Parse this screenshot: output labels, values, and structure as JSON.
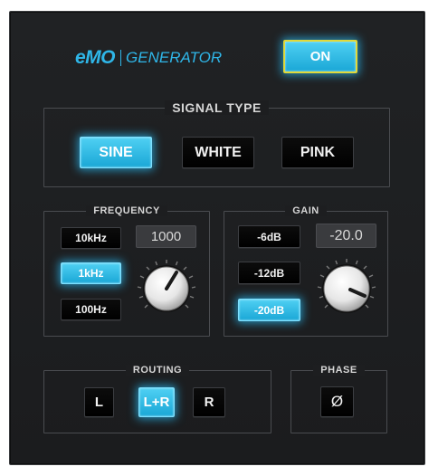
{
  "header": {
    "logo_text": "eMO",
    "product_name": "GENERATOR",
    "on_label": "ON"
  },
  "signal_type": {
    "title": "SIGNAL TYPE",
    "options": [
      {
        "label": "SINE",
        "selected": true
      },
      {
        "label": "WHITE",
        "selected": false
      },
      {
        "label": "PINK",
        "selected": false
      }
    ]
  },
  "frequency": {
    "title": "FREQUENCY",
    "presets": [
      {
        "label": "10kHz",
        "selected": false
      },
      {
        "label": "1kHz",
        "selected": true
      },
      {
        "label": "100Hz",
        "selected": false
      }
    ],
    "value": "1000"
  },
  "gain": {
    "title": "GAIN",
    "presets": [
      {
        "label": "-6dB",
        "selected": false
      },
      {
        "label": "-12dB",
        "selected": false
      },
      {
        "label": "-20dB",
        "selected": true
      }
    ],
    "value": "-20.0"
  },
  "routing": {
    "title": "ROUTING",
    "options": [
      {
        "label": "L",
        "selected": false
      },
      {
        "label": "L+R",
        "selected": true
      },
      {
        "label": "R",
        "selected": false
      }
    ]
  },
  "phase": {
    "title": "PHASE",
    "invert_label": "Ø"
  },
  "colors": {
    "accent": "#29b6e6",
    "on_button_border": "#e0d83a",
    "panel_background": "#1d1e20"
  }
}
